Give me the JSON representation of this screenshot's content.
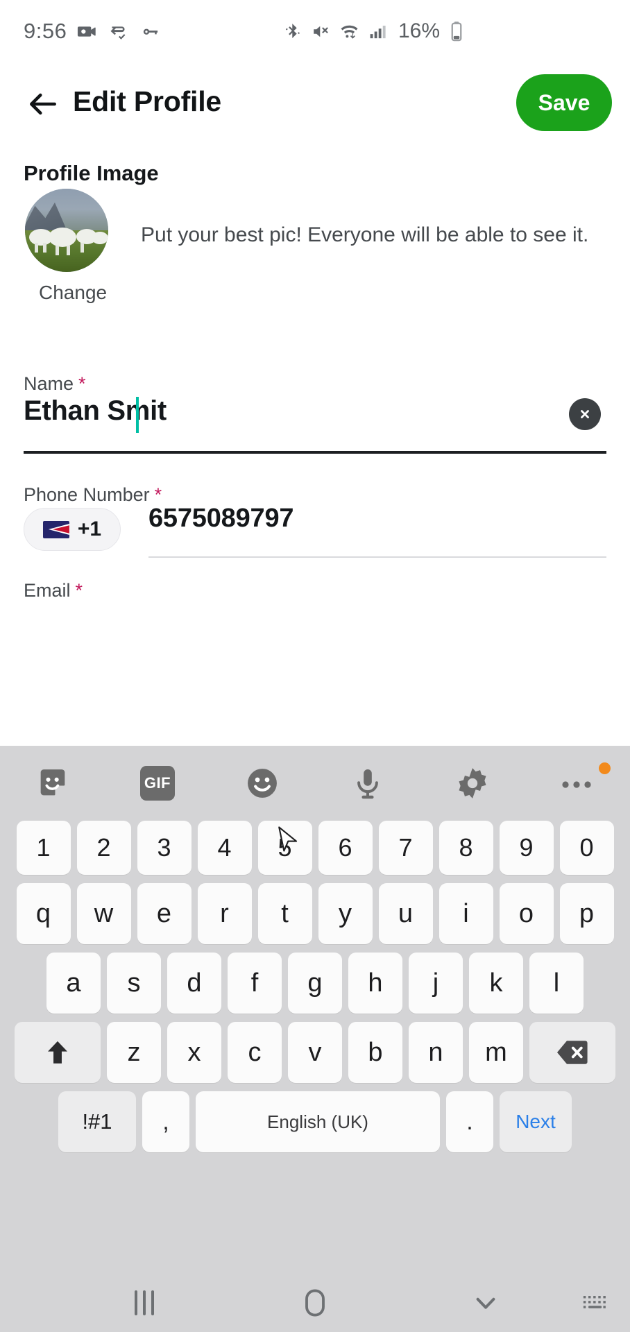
{
  "status_bar": {
    "time": "9:56",
    "battery_percent": "16%",
    "left_icons": [
      "camera-icon",
      "vpn-icon",
      "key-icon"
    ],
    "right_icons": [
      "bluetooth-icon",
      "volume-mute-icon",
      "wifi-icon",
      "signal-icon",
      "battery-icon"
    ]
  },
  "app_bar": {
    "back_icon": "back-arrow-icon",
    "title": "Edit Profile",
    "save_label": "Save",
    "save_color": "#1ba21b"
  },
  "form": {
    "profile_image": {
      "section_label": "Profile Image",
      "change_label": "Change",
      "hint": "Put your best pic! Everyone will be able to see it."
    },
    "name": {
      "label": "Name",
      "required_mark": "*",
      "value": "Ethan Smit",
      "clear_icon": "clear-circle-icon",
      "caret_color": "#00bfa5"
    },
    "phone": {
      "label": "Phone Number",
      "required_mark": "*",
      "country_code": "+1",
      "flag_icon": "american-samoa-flag-icon",
      "value": "6575089797"
    },
    "email": {
      "label": "Email",
      "required_mark": "*"
    }
  },
  "keyboard": {
    "toolbar": [
      {
        "name": "sticker-icon",
        "label": ""
      },
      {
        "name": "gif-icon",
        "label": "GIF"
      },
      {
        "name": "emoji-icon",
        "label": ""
      },
      {
        "name": "microphone-icon",
        "label": ""
      },
      {
        "name": "settings-gear-icon",
        "label": ""
      },
      {
        "name": "more-options-icon",
        "label": ""
      }
    ],
    "row_numbers": [
      "1",
      "2",
      "3",
      "4",
      "5",
      "6",
      "7",
      "8",
      "9",
      "0"
    ],
    "row_top": [
      "q",
      "w",
      "e",
      "r",
      "t",
      "y",
      "u",
      "i",
      "o",
      "p"
    ],
    "row_home": [
      "a",
      "s",
      "d",
      "f",
      "g",
      "h",
      "j",
      "k",
      "l"
    ],
    "row_bottom": [
      "z",
      "x",
      "c",
      "v",
      "b",
      "n",
      "m"
    ],
    "shift_icon": "shift-up-arrow-icon",
    "backspace_icon": "backspace-icon",
    "symbols_label": "!#1",
    "comma_label": ",",
    "space_label": "English (UK)",
    "period_label": ".",
    "next_label": "Next",
    "next_color": "#2a7fe8"
  },
  "nav_bar": {
    "recents_icon": "recents-icon",
    "home_icon": "home-icon",
    "hide_keyboard_icon": "chevron-down-icon",
    "keyboard_switch_icon": "keyboard-switch-icon"
  }
}
